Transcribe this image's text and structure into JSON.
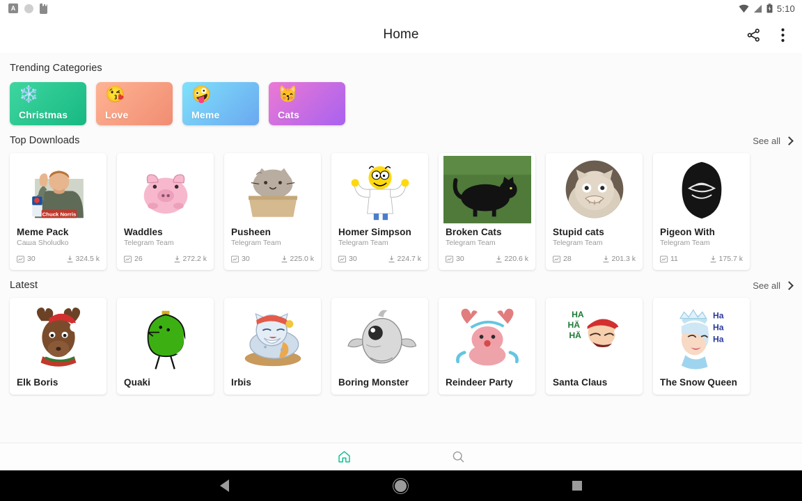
{
  "statusbar": {
    "left_icons": [
      "letter-a-icon",
      "circle-icon",
      "sd-card-icon"
    ],
    "a_glyph": "A",
    "right_icons": [
      "wifi-icon",
      "signal-icon",
      "battery-icon"
    ],
    "time": "5:10"
  },
  "appbar": {
    "title": "Home",
    "share_label": "share-icon",
    "overflow_label": "more-vert-icon"
  },
  "trending": {
    "title": "Trending Categories",
    "items": [
      {
        "label": "Christmas",
        "emoji": "❄️",
        "c1": "#3fd6a0",
        "c2": "#17b882"
      },
      {
        "label": "Love",
        "emoji": "😘",
        "c1": "#ffb394",
        "c2": "#f08d72"
      },
      {
        "label": "Meme",
        "emoji": "🤪",
        "c1": "#7fe1fb",
        "c2": "#6aa8f0"
      },
      {
        "label": "Cats",
        "emoji": "😽",
        "c1": "#ec79d4",
        "c2": "#a862ef"
      }
    ]
  },
  "top_downloads": {
    "title": "Top Downloads",
    "see_all": "See all",
    "items": [
      {
        "name": "Meme Pack",
        "author": "Саша Sholudko",
        "count": "30",
        "downloads": "324.5 k",
        "art": "chuck"
      },
      {
        "name": "Waddles",
        "author": "Telegram Team",
        "count": "26",
        "downloads": "272.2 k",
        "art": "pig"
      },
      {
        "name": "Pusheen",
        "author": "Telegram Team",
        "count": "30",
        "downloads": "225.0 k",
        "art": "pusheen"
      },
      {
        "name": "Homer Simpson",
        "author": "Telegram Team",
        "count": "30",
        "downloads": "224.7 k",
        "art": "homer"
      },
      {
        "name": "Broken Cats",
        "author": "Telegram Team",
        "count": "30",
        "downloads": "220.6 k",
        "art": "blackcat"
      },
      {
        "name": "Stupid cats",
        "author": "Telegram Team",
        "count": "28",
        "downloads": "201.3 k",
        "art": "stupidcat"
      },
      {
        "name": "Pigeon With",
        "author": "Telegram Team",
        "count": "11",
        "downloads": "175.7 k",
        "art": "pigeon"
      }
    ]
  },
  "latest": {
    "title": "Latest",
    "see_all": "See all",
    "items": [
      {
        "name": "Elk Boris",
        "art": "elk"
      },
      {
        "name": "Quaki",
        "art": "quaki"
      },
      {
        "name": "Irbis",
        "art": "irbis"
      },
      {
        "name": "Boring Monster",
        "art": "monster"
      },
      {
        "name": "Reindeer Party",
        "art": "reindeer"
      },
      {
        "name": "Santa Claus",
        "art": "santa"
      },
      {
        "name": "The Snow Queen",
        "art": "queen"
      }
    ]
  },
  "bottomnav": {
    "items": [
      {
        "name": "home",
        "active": true
      },
      {
        "name": "search",
        "active": false
      }
    ],
    "active_color": "#00c08b",
    "inactive_color": "#9b9b9b"
  },
  "sysnav": {
    "back": "back-triangle",
    "home": "home-circle",
    "recents": "recents-square"
  }
}
